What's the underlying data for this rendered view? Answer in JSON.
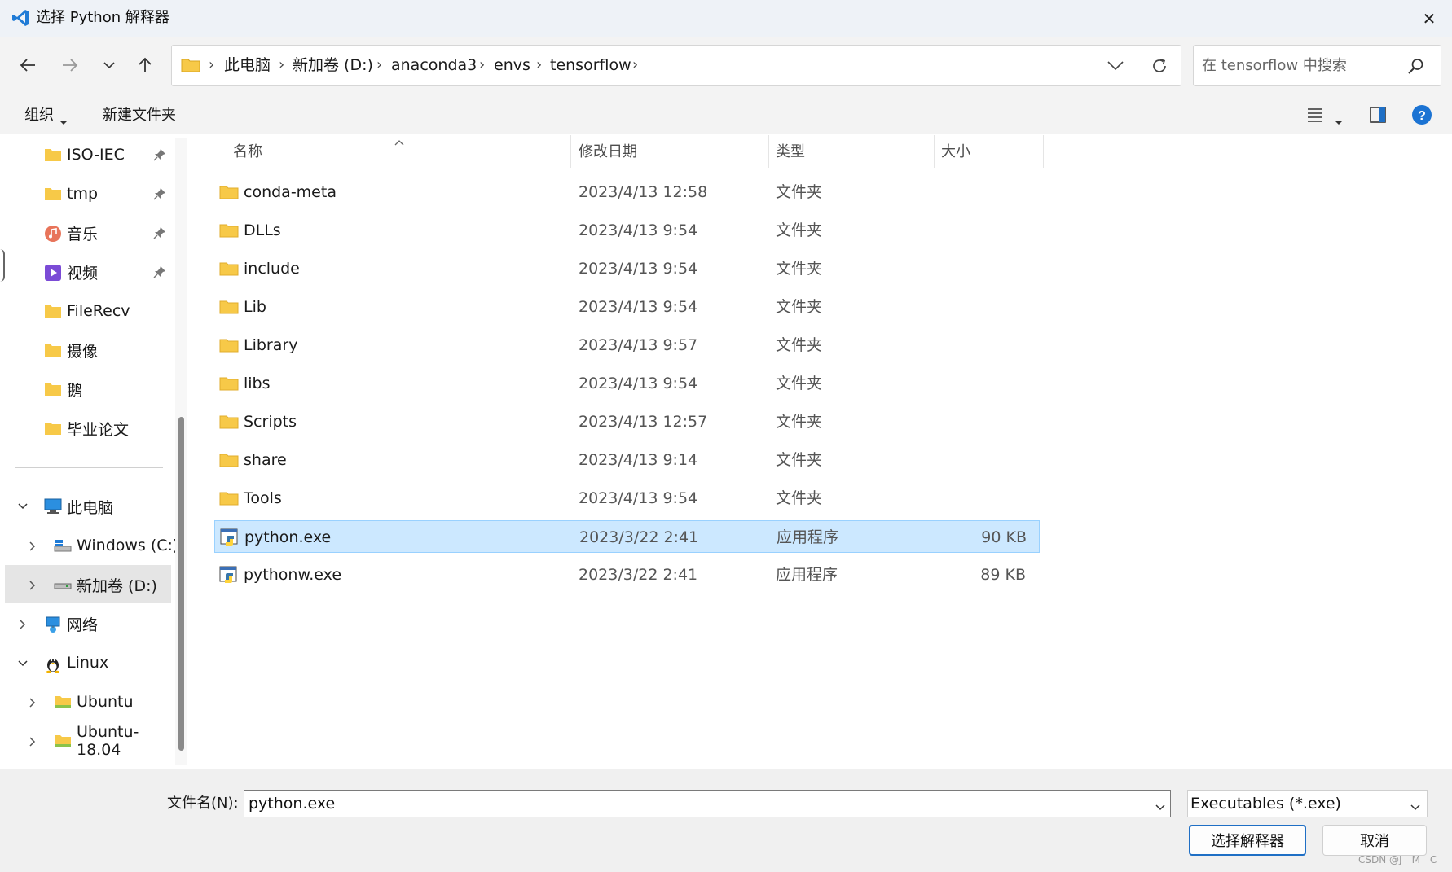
{
  "window": {
    "title": "选择 Python 解释器",
    "close_label": "✕"
  },
  "address": {
    "breadcrumbs": [
      "此电脑",
      "新加卷 (D:)",
      "anaconda3",
      "envs",
      "tensorflow"
    ],
    "search_placeholder": "在 tensorflow 中搜索"
  },
  "toolbar": {
    "organize_label": "组织",
    "new_folder_label": "新建文件夹"
  },
  "sidebar": {
    "quick_access": [
      {
        "label": "ISO-IEC",
        "icon": "folder-icon",
        "pinned": true
      },
      {
        "label": "tmp",
        "icon": "folder-icon",
        "pinned": true
      },
      {
        "label": "音乐",
        "icon": "music-icon",
        "pinned": true
      },
      {
        "label": "视频",
        "icon": "video-icon",
        "pinned": true
      },
      {
        "label": "FileRecv",
        "icon": "folder-icon",
        "pinned": false
      },
      {
        "label": "摄像",
        "icon": "folder-icon",
        "pinned": false
      },
      {
        "label": "鹅",
        "icon": "folder-icon",
        "pinned": false
      },
      {
        "label": "毕业论文",
        "icon": "folder-icon",
        "pinned": false
      }
    ],
    "tree": [
      {
        "label": "此电脑",
        "icon": "computer-icon",
        "expanded": true
      },
      {
        "label": "Windows (C:)",
        "icon": "windows-drive-icon",
        "expanded": false
      },
      {
        "label": "新加卷 (D:)",
        "icon": "drive-icon",
        "expanded": false,
        "selected": true
      },
      {
        "label": "网络",
        "icon": "network-icon",
        "expanded": false
      },
      {
        "label": "Linux",
        "icon": "linux-icon",
        "expanded": true
      },
      {
        "label": "Ubuntu",
        "icon": "folder-icon",
        "expanded": false
      },
      {
        "label": "Ubuntu-18.04",
        "icon": "folder-icon",
        "expanded": false
      }
    ]
  },
  "columns": {
    "name": "名称",
    "modified": "修改日期",
    "type": "类型",
    "size": "大小"
  },
  "files": [
    {
      "name": "conda-meta",
      "modified": "2023/4/13 12:58",
      "type": "文件夹",
      "size": "",
      "icon": "folder-icon"
    },
    {
      "name": "DLLs",
      "modified": "2023/4/13 9:54",
      "type": "文件夹",
      "size": "",
      "icon": "folder-icon"
    },
    {
      "name": "include",
      "modified": "2023/4/13 9:54",
      "type": "文件夹",
      "size": "",
      "icon": "folder-icon"
    },
    {
      "name": "Lib",
      "modified": "2023/4/13 9:54",
      "type": "文件夹",
      "size": "",
      "icon": "folder-icon"
    },
    {
      "name": "Library",
      "modified": "2023/4/13 9:57",
      "type": "文件夹",
      "size": "",
      "icon": "folder-icon"
    },
    {
      "name": "libs",
      "modified": "2023/4/13 9:54",
      "type": "文件夹",
      "size": "",
      "icon": "folder-icon"
    },
    {
      "name": "Scripts",
      "modified": "2023/4/13 12:57",
      "type": "文件夹",
      "size": "",
      "icon": "folder-icon"
    },
    {
      "name": "share",
      "modified": "2023/4/13 9:14",
      "type": "文件夹",
      "size": "",
      "icon": "folder-icon"
    },
    {
      "name": "Tools",
      "modified": "2023/4/13 9:54",
      "type": "文件夹",
      "size": "",
      "icon": "folder-icon"
    },
    {
      "name": "python.exe",
      "modified": "2023/3/22 2:41",
      "type": "应用程序",
      "size": "90 KB",
      "icon": "python-exe-icon",
      "selected": true
    },
    {
      "name": "pythonw.exe",
      "modified": "2023/3/22 2:41",
      "type": "应用程序",
      "size": "89 KB",
      "icon": "pythonw-exe-icon"
    }
  ],
  "bottom": {
    "filename_label": "文件名(N):",
    "filename_value": "python.exe",
    "filter_value": "Executables (*.exe)",
    "ok_label": "选择解释器",
    "cancel_label": "取消"
  },
  "watermark": "CSDN @J__M__C",
  "colors": {
    "selection_bg": "#cce8ff",
    "accent": "#1f6fc5",
    "folder": "#f7c948"
  }
}
